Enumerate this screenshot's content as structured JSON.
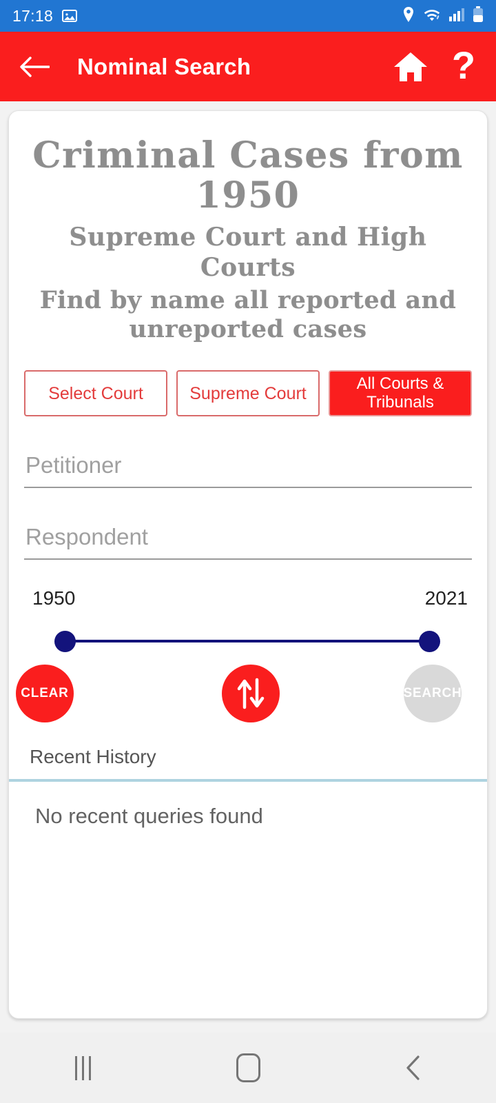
{
  "status_bar": {
    "time": "17:18",
    "icons": [
      "screenshot-image-icon",
      "location-icon",
      "wifi-icon",
      "signal-icon",
      "battery-icon"
    ],
    "background_color": "#2176D2"
  },
  "app_bar": {
    "title": "Nominal Search",
    "back_icon": "back-arrow-icon",
    "home_icon": "home-icon",
    "help_label": "?",
    "background_color": "#FA1E1E"
  },
  "card": {
    "heading": {
      "line1": "Criminal Cases from",
      "line2": "1950",
      "line3": "Supreme Court and High Courts",
      "line4": "Find by name all reported and",
      "line5": "unreported cases"
    },
    "court_buttons": [
      {
        "label": "Select Court",
        "active": false
      },
      {
        "label": "Supreme Court",
        "active": false
      },
      {
        "label": "All Courts & Tribunals",
        "active": true
      }
    ],
    "fields": [
      {
        "name": "petitioner",
        "placeholder": "Petitioner",
        "value": ""
      },
      {
        "name": "respondent",
        "placeholder": "Respondent",
        "value": ""
      }
    ],
    "year_slider": {
      "min_label": "1950",
      "max_label": "2021",
      "min_value": 1950,
      "max_value": 2021,
      "thumb_color": "#13137C"
    },
    "actions": {
      "clear_label": "CLEAR",
      "swap_icon": "swap-vertical-arrows-icon",
      "search_label": "SEARCH",
      "search_enabled": false,
      "accent_color": "#FA1E1E",
      "disabled_color": "#D9D9D9"
    },
    "history": {
      "label": "Recent History",
      "empty_message": "No recent queries found",
      "divider_color": "#AED3E0"
    }
  },
  "nav_bar": {
    "recents_icon": "recents-icon",
    "home_icon": "home-square-icon",
    "back_icon": "back-chevron-icon"
  }
}
